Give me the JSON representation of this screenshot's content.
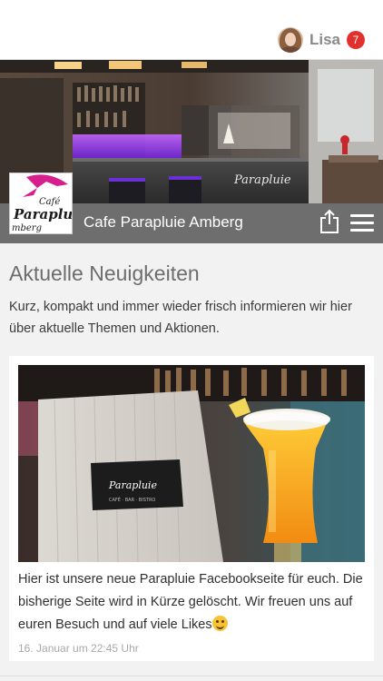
{
  "header": {
    "user_name": "Lisa",
    "notification_count": "7",
    "avatar_icon": "user-avatar-icon"
  },
  "venue": {
    "title": "Cafe Parapluie Amberg",
    "logo_text_top": "Café",
    "logo_text_main": "Paraplu",
    "logo_text_bottom": "mberg",
    "hero_sign": "Parapluie",
    "share_icon": "share-icon",
    "menu_icon": "hamburger-menu-icon"
  },
  "news": {
    "title": "Aktuelle Neuigkeiten",
    "description": "Kurz, kompakt und immer wieder frisch informieren wir hier über aktuelle Themen und Aktionen.",
    "posts": [
      {
        "image_sign": "Parapluie",
        "image_sign_sub": "CAFÉ · BAR · BISTRO",
        "text": "Hier ist unsere neue Parapluie Facebookseite für euch. Die bisherige Seite wird in Kürze gelöscht. Wir freuen uns auf euren Besuch und auf viele Likes",
        "emoji": "smiling-face-emoji",
        "date": "16. Januar um 22:45 Uhr"
      }
    ]
  },
  "colors": {
    "badge": "#e2312d",
    "titlebar": "#6e6e6e",
    "background": "#f2f2f2",
    "bar_light": "#9b3cff"
  }
}
